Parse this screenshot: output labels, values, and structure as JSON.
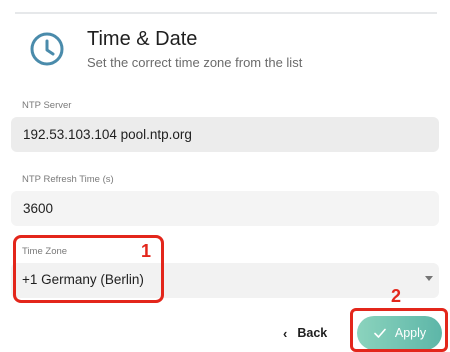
{
  "header": {
    "icon": "clock-icon",
    "title": "Time & Date",
    "subtitle": "Set the correct time zone from the list"
  },
  "fields": {
    "ntp_server": {
      "label": "NTP Server",
      "value": "192.53.103.104 pool.ntp.org"
    },
    "ntp_refresh": {
      "label": "NTP Refresh Time (s)",
      "value": "3600"
    },
    "time_zone": {
      "label": "Time Zone",
      "value": "+1 Germany (Berlin)"
    }
  },
  "annotations": {
    "step1": "1",
    "step2": "2",
    "color": "#e3261b"
  },
  "buttons": {
    "back": {
      "label": "Back",
      "icon": "chevron-left-icon"
    },
    "apply": {
      "label": "Apply",
      "icon": "check-icon"
    }
  },
  "colors": {
    "accent": "#5db6a8",
    "clock": "#4a8bab"
  }
}
